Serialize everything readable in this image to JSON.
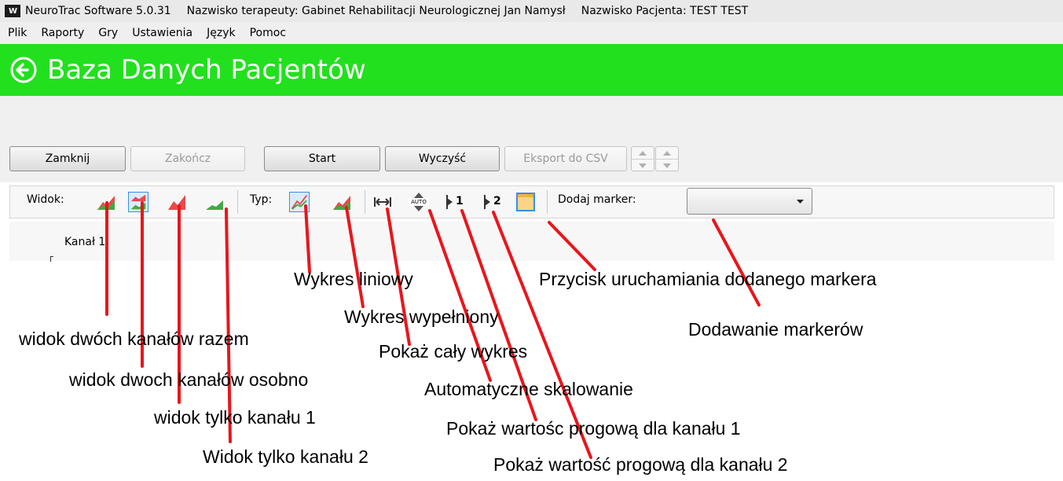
{
  "window": {
    "app_title": "NeuroTrac Software 5.0.31",
    "therapist": "Nazwisko terapeuty: Gabinet Rehabilitacji Neurologicznej Jan Namysł",
    "patient": "Nazwisko Pacjenta: TEST TEST",
    "logo_text": "W"
  },
  "menu": [
    "Plik",
    "Raporty",
    "Gry",
    "Ustawienia",
    "Język",
    "Pomoc"
  ],
  "header": {
    "title": "Baza Danych Pacjentów",
    "color": "#22e01e"
  },
  "buttons": {
    "close": "Zamknij",
    "finish": "Zakończ",
    "start": "Start",
    "clear": "Wyczyść",
    "export": "Eksport do CSV"
  },
  "toolbar": {
    "view_label": "Widok:",
    "type_label": "Typ:",
    "threshold1": "1",
    "threshold2": "2",
    "auto_text": "AUTO",
    "add_marker_label": "Dodaj marker:",
    "marker_select_value": ""
  },
  "channel": {
    "label": "Kanał 1"
  },
  "annotations": {
    "line_chart": "Wykres liniowy",
    "marker_button": "Przycisk uruchamiania dodanego markera",
    "filled_chart": "Wykres wypełniony",
    "both_together": "widok dwóch kanałów razem",
    "add_markers": "Dodawanie markerów",
    "show_all": "Pokaż cały wykres",
    "both_separate": "widok dwoch kanałów osobno",
    "auto_scale": "Automatyczne skalowanie",
    "only_ch1": "widok tylko kanału 1",
    "threshold_ch1": "Pokaż wartośc progową dla kanału 1",
    "only_ch2": "Widok tylko kanału 2",
    "threshold_ch2": "Pokaż wartość progową dla kanału 2"
  },
  "colors": {
    "annotation_line": "#e8161c",
    "selected_border": "#3a8ee6"
  }
}
